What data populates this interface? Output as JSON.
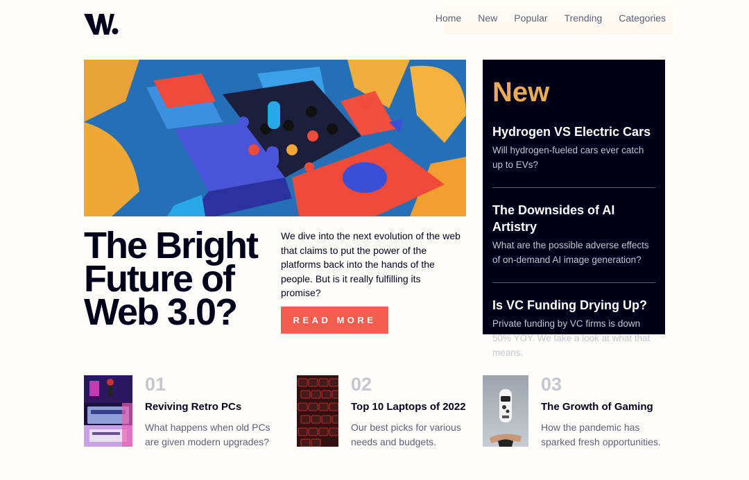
{
  "brand": {
    "logo_text": "W."
  },
  "nav": {
    "items": [
      "Home",
      "New",
      "Popular",
      "Trending",
      "Categories"
    ]
  },
  "hero": {
    "title": "The Bright Future of Web 3.0?",
    "description": "We dive into the next evolution of the web that claims to put the power of the platforms back into the hands of the people. But is it really fulfilling its promise?",
    "button_label": "READ MORE"
  },
  "new_panel": {
    "heading": "New",
    "items": [
      {
        "title": "Hydrogen VS Electric Cars",
        "desc": "Will hydrogen-fueled cars ever catch up to EVs?"
      },
      {
        "title": "The Downsides of AI Artistry",
        "desc": "What are the possible adverse effects of on-demand AI image generation?"
      },
      {
        "title": "Is VC Funding Drying Up?",
        "desc": "Private funding by VC firms is down 50% YOY. We take a look at what that means."
      }
    ]
  },
  "cards": [
    {
      "num": "01",
      "title": "Reviving Retro PCs",
      "desc": "What happens when old PCs are given modern upgrades?"
    },
    {
      "num": "02",
      "title": "Top 10 Laptops of 2022",
      "desc": "Our best picks for various needs and budgets."
    },
    {
      "num": "03",
      "title": "The Growth of Gaming",
      "desc": "How the pandemic has sparked fresh opportunities."
    }
  ],
  "colors": {
    "accent_red": "#f15e50",
    "accent_orange": "#e9ab53",
    "dark_blue": "#00001a",
    "grayish_blue": "#5d5f79",
    "off_white": "#fffdfa"
  }
}
